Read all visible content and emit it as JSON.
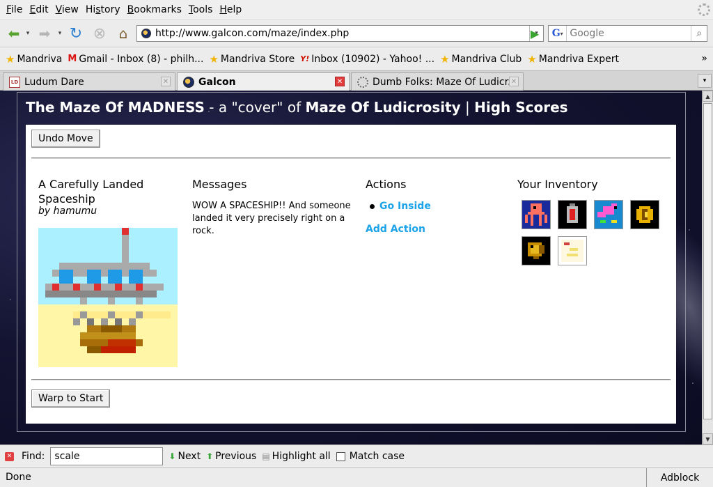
{
  "menu": [
    {
      "label": "File",
      "accel": "F",
      "rest": "ile"
    },
    {
      "label": "Edit",
      "accel": "E",
      "rest": "dit"
    },
    {
      "label": "View",
      "accel": "V",
      "rest": "iew"
    },
    {
      "label": "History",
      "accel": "",
      "pre": "Hi",
      "u": "s",
      "post": "tory"
    },
    {
      "label": "Bookmarks",
      "accel": "B",
      "rest": "ookmarks"
    },
    {
      "label": "Tools",
      "accel": "T",
      "rest": "ools"
    },
    {
      "label": "Help",
      "accel": "H",
      "rest": "elp"
    }
  ],
  "nav": {
    "url": "http://www.galcon.com/maze/index.php",
    "search_placeholder": "Google"
  },
  "bookmarks": [
    {
      "label": "Mandriva",
      "icon": "star"
    },
    {
      "label": "Gmail - Inbox (8) - philh...",
      "icon": "gmail"
    },
    {
      "label": "Mandriva Store",
      "icon": "star"
    },
    {
      "label": "Inbox (10902) - Yahoo! ...",
      "icon": "yahoo"
    },
    {
      "label": "Mandriva Club",
      "icon": "star"
    },
    {
      "label": "Mandriva Expert",
      "icon": "star"
    }
  ],
  "bookmarks_more": "»",
  "tabs": [
    {
      "label": "Ludum Dare",
      "active": false
    },
    {
      "label": "Galcon",
      "active": true
    },
    {
      "label": "Dumb Folks: Maze Of Ludicr...",
      "active": false
    }
  ],
  "page": {
    "title_part1": "The Maze Of MADNESS",
    "title_part2": " - a \"cover\" of ",
    "title_part3": "Maze Of Ludicrosity",
    "title_sep": " | ",
    "title_link": "High Scores",
    "undo_button": "Undo Move",
    "room_title": "A Carefully Landed Spaceship",
    "room_byline": "by hamumu",
    "messages_heading": "Messages",
    "message_text": "WOW A SPACESHIP!! And someone landed it very precisely right on a rock.",
    "actions_heading": "Actions",
    "actions": [
      "Go Inside",
      "Add Action"
    ],
    "inventory_heading": "Your Inventory",
    "inventory_items": [
      "octopus-icon",
      "battery-icon",
      "pink-creature-icon",
      "gold-coin-icon",
      "golden-fish-icon",
      "note-icon"
    ],
    "warp_button": "Warp to Start"
  },
  "findbar": {
    "label": "Find:",
    "value": "scale",
    "next": "Next",
    "previous": "Previous",
    "highlight": "Highlight all",
    "match_case": "Match case"
  },
  "status": {
    "text": "Done",
    "adblock": "Adblock"
  }
}
